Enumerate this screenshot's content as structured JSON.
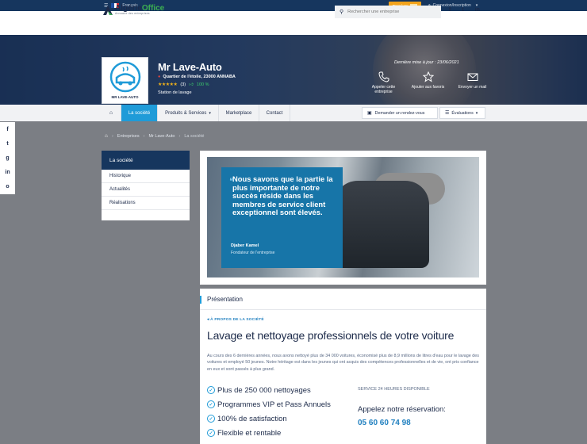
{
  "topbar": {
    "language": "Français",
    "premium_label": "Premium",
    "premium_badge": "",
    "login_label": "Connexion/Inscription"
  },
  "header": {
    "logo_main": "Algérie",
    "logo_accent": "Office",
    "logo_tagline": "Annuaire des entreprises",
    "search_placeholder": "Rechercher une entreprise",
    "social": [
      "f",
      "t",
      "in"
    ]
  },
  "company": {
    "name": "Mr Lave-Auto",
    "logo_caption": "MR LAVE-AUTO",
    "address": "Quartier de l'étoile, 23000 ANNABA",
    "stars": "★★★★★",
    "rating_count": "(3)",
    "recommend_pct": "100 %",
    "category": "Station de lavage",
    "last_update": "Dernière mise à jour : 23/06/2021"
  },
  "actions": [
    {
      "label": "Appeler cette entreprise",
      "icon": "phone-icon"
    },
    {
      "label": "Ajouter aux favoris",
      "icon": "star-icon"
    },
    {
      "label": "Envoyer un mail",
      "icon": "mail-icon"
    }
  ],
  "nav": {
    "home_icon": "home-icon",
    "tabs": [
      "La société",
      "Produits & Services",
      "Marketplace",
      "Contact"
    ],
    "appointment": "Demander un rendez-vous",
    "reviews": "Évaluations"
  },
  "share": [
    "f",
    "t",
    "g",
    "in",
    "o"
  ],
  "breadcrumb": [
    "Entreprises",
    "Mr Lave-Auto",
    "La société"
  ],
  "sidebar": {
    "title": "La société",
    "items": [
      "Historique",
      "Actualités",
      "Réalisations"
    ]
  },
  "quote": {
    "mark": "❝",
    "text": "Nous savons que la partie la plus importante de notre succès réside dans les membres de service client exceptionnel sont élevés.",
    "author": "Djaber Kamel",
    "role": "Fondateur de l'entreprise"
  },
  "presentation": {
    "heading": "Présentation",
    "kicker": "À PROPOS DE LA SOCIÉTÉ",
    "title": "Lavage et nettoyage professionnels de votre voiture",
    "body": "Au cours des 6 dernières années, nous avons nettoyé plus de 34 000 voitures, économisé plus de 8,9 millions de litres d'eau pour le lavage des voitures et employé 50 jeunes. Notre héritage est dans les jeunes qui ont acquis des compétences professionnelles et de vie, ont pris confiance en eux et sont passés à plus grand.",
    "features": [
      "Plus de 250 000 nettoyages",
      "Programmes VIP et Pass Annuels",
      "100% de satisfaction",
      "Flexible et rentable"
    ],
    "service_note": "SERVICE 24 HEURES DISPONIBLE",
    "call_label": "Appelez notre réservation:",
    "phone": "05 60 60 74 98"
  },
  "colors": {
    "navy": "#16365e",
    "accent_blue": "#1f9bd8",
    "premium_orange": "#f2a31c",
    "star_gold": "#f2b21a",
    "logo_green": "#3cae52"
  }
}
